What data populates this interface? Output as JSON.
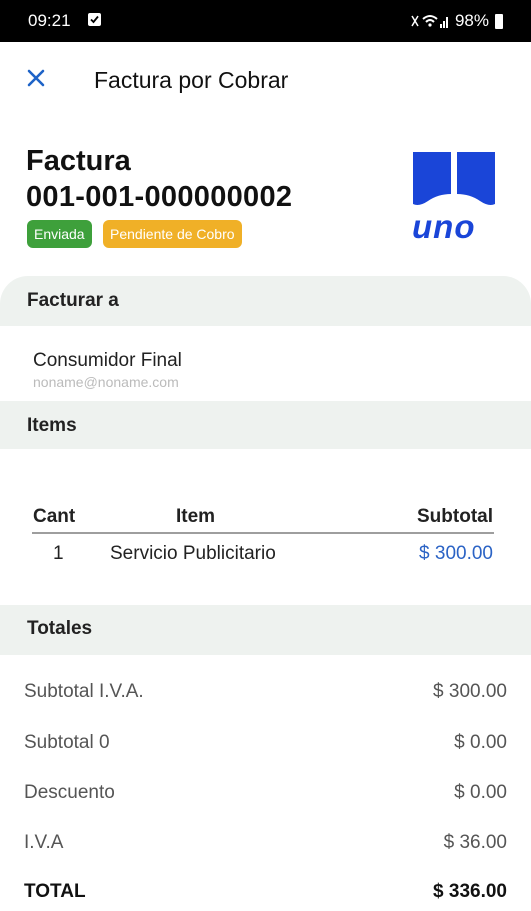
{
  "status_bar": {
    "time": "09:21",
    "battery": "98%"
  },
  "app_bar": {
    "title": "Factura por Cobrar"
  },
  "invoice": {
    "label": "Factura",
    "number": "001-001-000000002",
    "badges": {
      "sent": "Enviada",
      "pending": "Pendiente de Cobro"
    },
    "badge_colors": {
      "sent": "#3ea03b",
      "pending": "#f0b027"
    }
  },
  "logo": {
    "text": "uno",
    "color": "#1a45d8"
  },
  "bill_to": {
    "section_label": "Facturar a",
    "name": "Consumidor Final",
    "email": "noname@noname.com"
  },
  "items": {
    "section_label": "Items",
    "headers": {
      "qty": "Cant",
      "item": "Item",
      "subtotal": "Subtotal"
    },
    "rows": [
      {
        "qty": "1",
        "item": "Servicio Publicitario",
        "subtotal": "$ 300.00"
      }
    ]
  },
  "totals": {
    "section_label": "Totales",
    "rows": [
      {
        "label": "Subtotal I.V.A.",
        "value": "$ 300.00"
      },
      {
        "label": "Subtotal 0",
        "value": "$ 0.00"
      },
      {
        "label": "Descuento",
        "value": "$ 0.00"
      },
      {
        "label": "I.V.A",
        "value": "$ 36.00"
      },
      {
        "label": "TOTAL",
        "value": "$ 336.00"
      }
    ]
  }
}
